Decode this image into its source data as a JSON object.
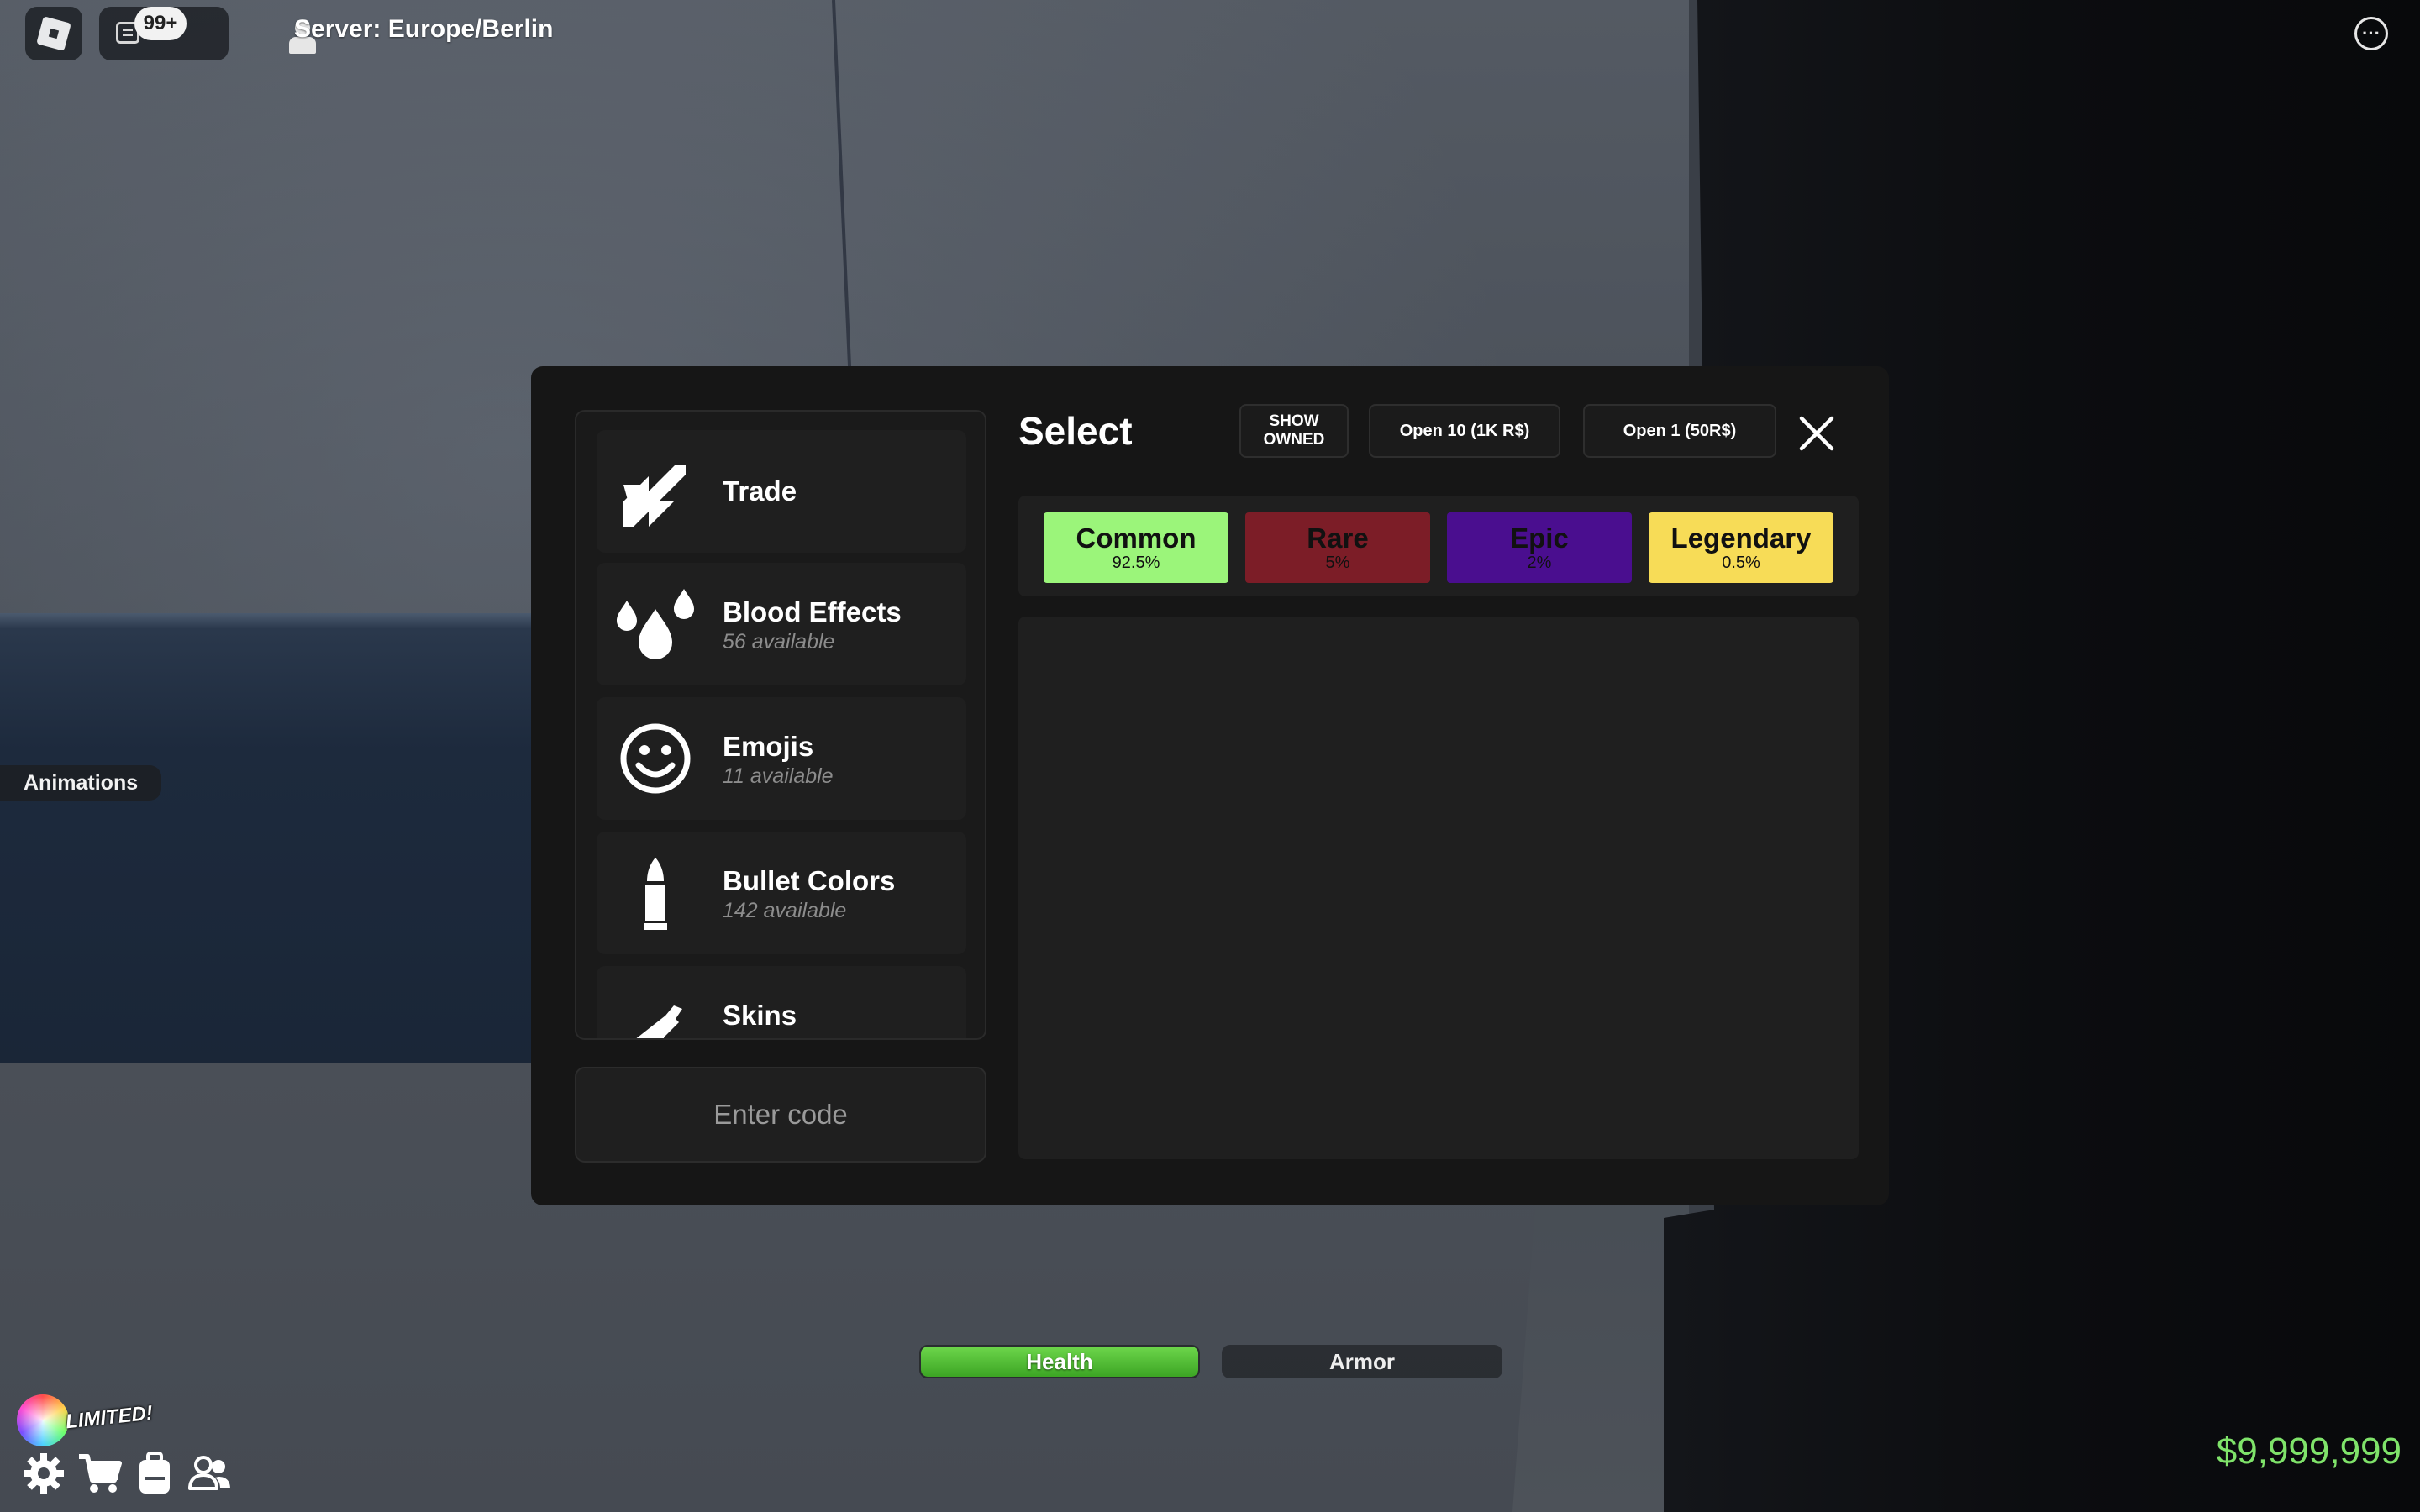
{
  "topbar": {
    "chat_badge": "99+",
    "server_label": "Server: Europe/Berlin",
    "more_symbol": "···"
  },
  "side": {
    "animations_label": "Animations"
  },
  "modal": {
    "categories": [
      {
        "title": "Trade",
        "subtitle": "",
        "icon": "trade-icon"
      },
      {
        "title": "Blood Effects",
        "subtitle": "56 available",
        "icon": "blood-drops-icon"
      },
      {
        "title": "Emojis",
        "subtitle": "11 available",
        "icon": "smiley-icon"
      },
      {
        "title": "Bullet Colors",
        "subtitle": "142 available",
        "icon": "bullet-icon"
      },
      {
        "title": "Skins",
        "subtitle": "",
        "icon": "gun-icon"
      }
    ],
    "code_placeholder": "Enter code",
    "select_title": "Select",
    "show_owned_line1": "SHOW",
    "show_owned_line2": "OWNED",
    "open10_label": "Open 10 (1K R$)",
    "open1_label": "Open 1 (50R$)",
    "rarities": [
      {
        "name": "Common",
        "percent": "92.5%",
        "color": "#9bf57a"
      },
      {
        "name": "Rare",
        "percent": "5%",
        "color": "#7c1d27"
      },
      {
        "name": "Epic",
        "percent": "2%",
        "color": "#4a0e8f"
      },
      {
        "name": "Legendary",
        "percent": "0.5%",
        "color": "#f7dc57"
      }
    ]
  },
  "hud": {
    "health_label": "Health",
    "health_fraction": 1.0,
    "armor_label": "Armor",
    "armor_fraction": 0,
    "money": "$9,999,999",
    "limited_label": "LIMITED!"
  }
}
